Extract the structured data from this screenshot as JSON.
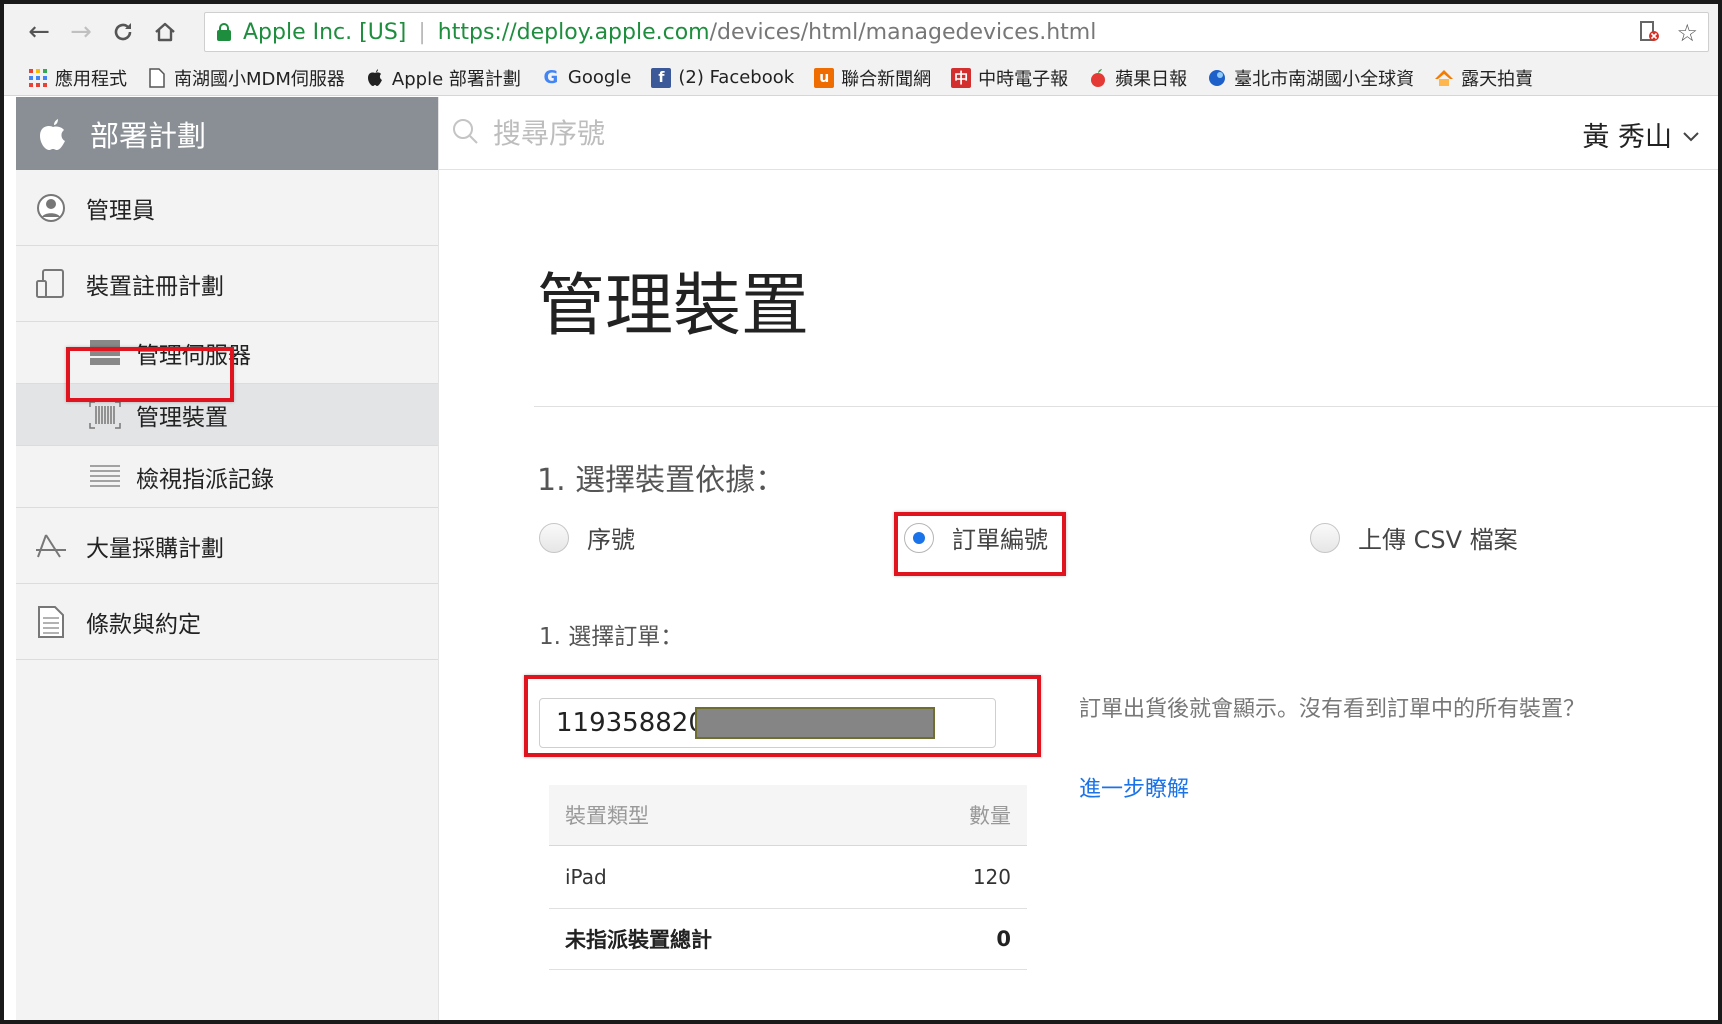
{
  "browser": {
    "site_name": "Apple Inc. [US]",
    "url_domain": "https://deploy.apple.com",
    "url_path": "/devices/html/managedevices.html",
    "bookmarks": [
      {
        "label": "應用程式",
        "icon": "apps-grid-icon"
      },
      {
        "label": "南湖國小MDM伺服器",
        "icon": "page-icon"
      },
      {
        "label": "Apple 部署計劃",
        "icon": "apple-icon"
      },
      {
        "label": "Google",
        "icon": "google-icon"
      },
      {
        "label": "(2) Facebook",
        "icon": "facebook-icon"
      },
      {
        "label": "聯合新聞網",
        "icon": "udn-icon"
      },
      {
        "label": "中時電子報",
        "icon": "chinatimes-icon"
      },
      {
        "label": "蘋果日報",
        "icon": "apple-daily-icon"
      },
      {
        "label": "臺北市南湖國小全球資",
        "icon": "globe-icon"
      },
      {
        "label": "露天拍賣",
        "icon": "ruten-icon"
      }
    ]
  },
  "sidebar": {
    "title": "部署計劃",
    "items": {
      "admin": "管理員",
      "dep": "裝置註冊計劃",
      "manage_servers": "管理伺服器",
      "manage_devices": "管理裝置",
      "view_assignments": "檢視指派記錄",
      "vpp": "大量採購計劃",
      "terms": "條款與約定"
    }
  },
  "search": {
    "placeholder": "搜尋序號",
    "value": ""
  },
  "user": {
    "name": "黃 秀山"
  },
  "main": {
    "title": "管理裝置",
    "step1_heading": "1. 選擇裝置依據：",
    "options": {
      "serial": "序號",
      "order": "訂單編號",
      "csv": "上傳 CSV 檔案"
    },
    "selected_option": "order",
    "sub_step": "1. 選擇訂單：",
    "order_number": "11935882016",
    "help_text": "訂單出貨後就會顯示。沒有看到訂單中的所有裝置？",
    "help_link": "進一步瞭解"
  },
  "device_table": {
    "headers": [
      "裝置類型",
      "數量"
    ],
    "rows": [
      {
        "type": "iPad",
        "count": "120"
      }
    ],
    "total_label": "未指派裝置總計",
    "total_value": "0"
  },
  "colors": {
    "accent": "#1a73e8",
    "highlight_box": "#e0141e",
    "sidebar_header": "#8a8f95",
    "secure_green": "#1e8e3e"
  }
}
